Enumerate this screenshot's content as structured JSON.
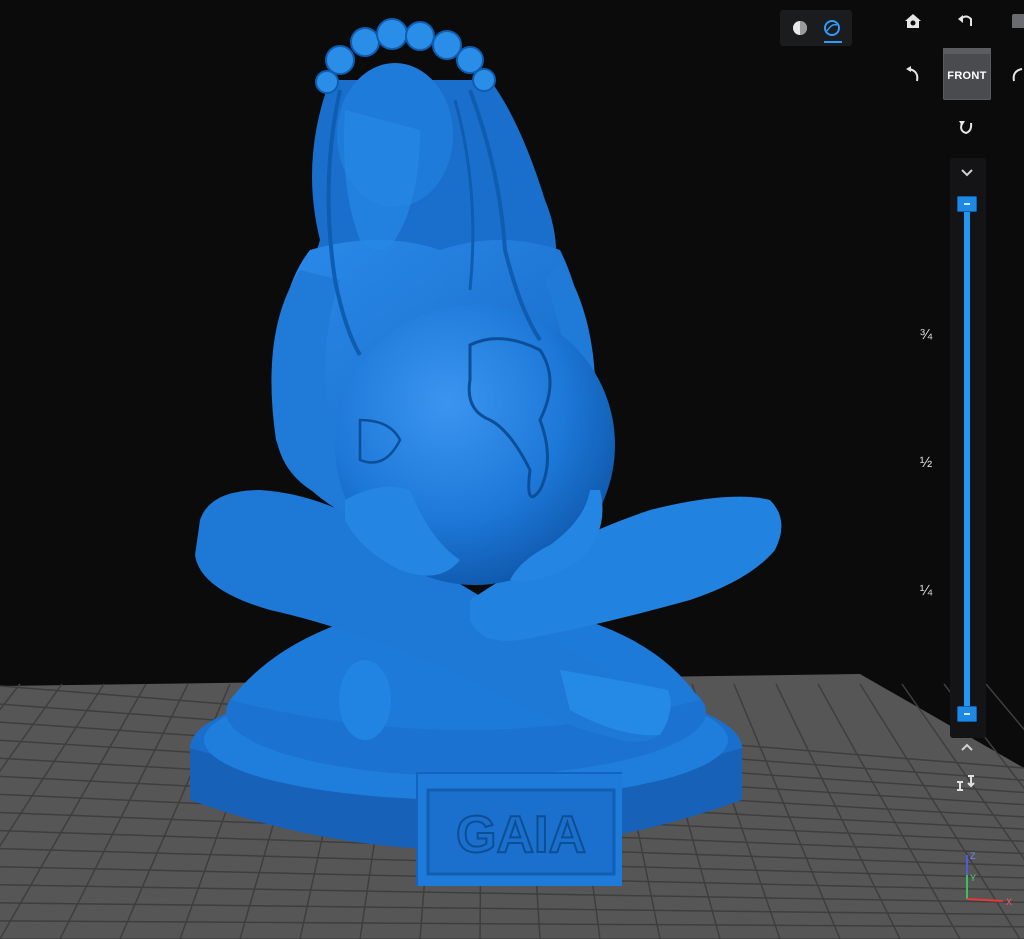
{
  "toolbar": {
    "view_modes": [
      "shaded-icon",
      "wireframe-icon"
    ],
    "icons": [
      "home-icon",
      "undo-icon",
      "rotate-left-icon",
      "rotate-right-icon",
      "rotate-down-icon"
    ]
  },
  "view_cube": {
    "face_label": "FRONT"
  },
  "layer_slider": {
    "ticks": [
      "¾",
      "½",
      "¼"
    ],
    "upper_value": 1.0,
    "lower_value": 0.0
  },
  "model": {
    "plaque_text": "GAIA",
    "color": "#1d78d8"
  },
  "axes": {
    "x": "X",
    "y": "Y",
    "z": "Z"
  },
  "colors": {
    "background": "#0b0b0c",
    "bed": "#575757",
    "grid": "#3d3d3d",
    "accent": "#2196f3",
    "model": "#1d78d8"
  }
}
